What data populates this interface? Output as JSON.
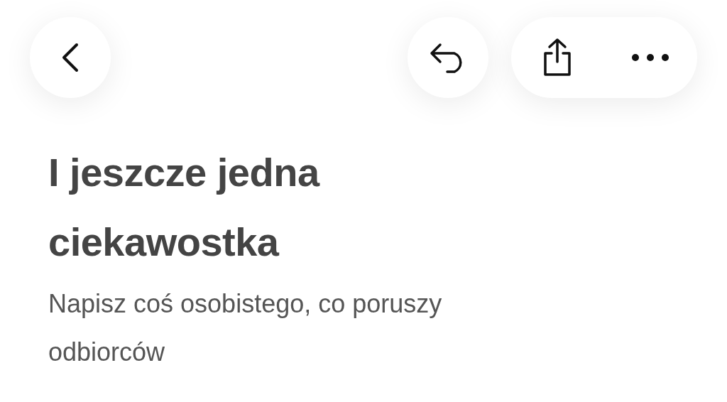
{
  "heading": "I jeszcze jedna ciekawostka",
  "subtitle": "Napisz coś osobistego, co poruszy odbiorców"
}
